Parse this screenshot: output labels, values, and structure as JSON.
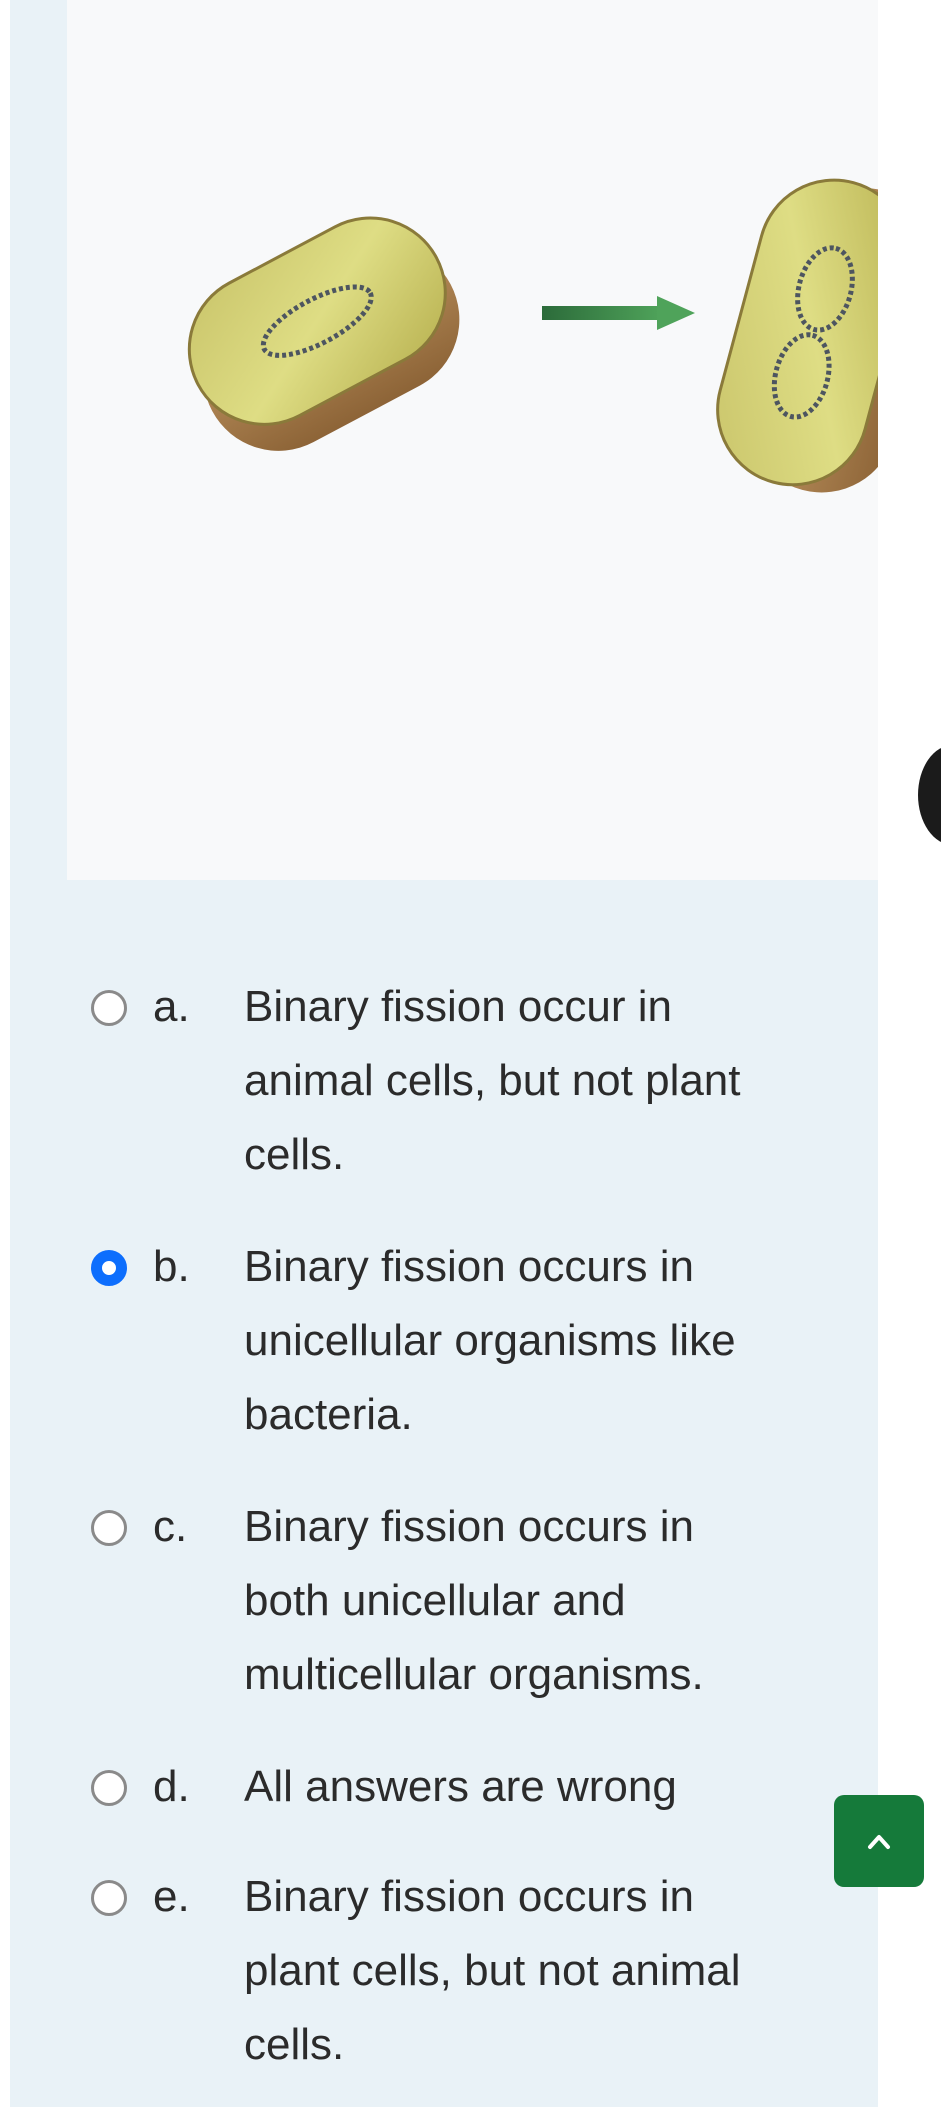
{
  "figure": {
    "description_icon": "binary-fission-diagram"
  },
  "options": [
    {
      "letter": "a.",
      "lines": [
        "Binary fission occur in",
        "animal cells, but not plant",
        "cells."
      ],
      "checked": false
    },
    {
      "letter": "b.",
      "lines": [
        "Binary fission occurs in",
        "unicellular organisms like",
        "bacteria."
      ],
      "checked": true
    },
    {
      "letter": "c.",
      "lines": [
        "Binary fission occurs in",
        "both unicellular and",
        "multicellular organisms."
      ],
      "checked": false
    },
    {
      "letter": "d.",
      "lines": [
        "All answers are wrong"
      ],
      "checked": false
    },
    {
      "letter": "e.",
      "lines": [
        "Binary fission occurs in",
        "plant cells, but not animal",
        "cells."
      ],
      "checked": false
    }
  ],
  "scroll_top_button": {
    "icon": "chevron-up-icon"
  },
  "colors": {
    "accent_radio": "#0d6efd",
    "scroll_button": "#157a3a",
    "panel_bg": "#e9f2f7"
  }
}
